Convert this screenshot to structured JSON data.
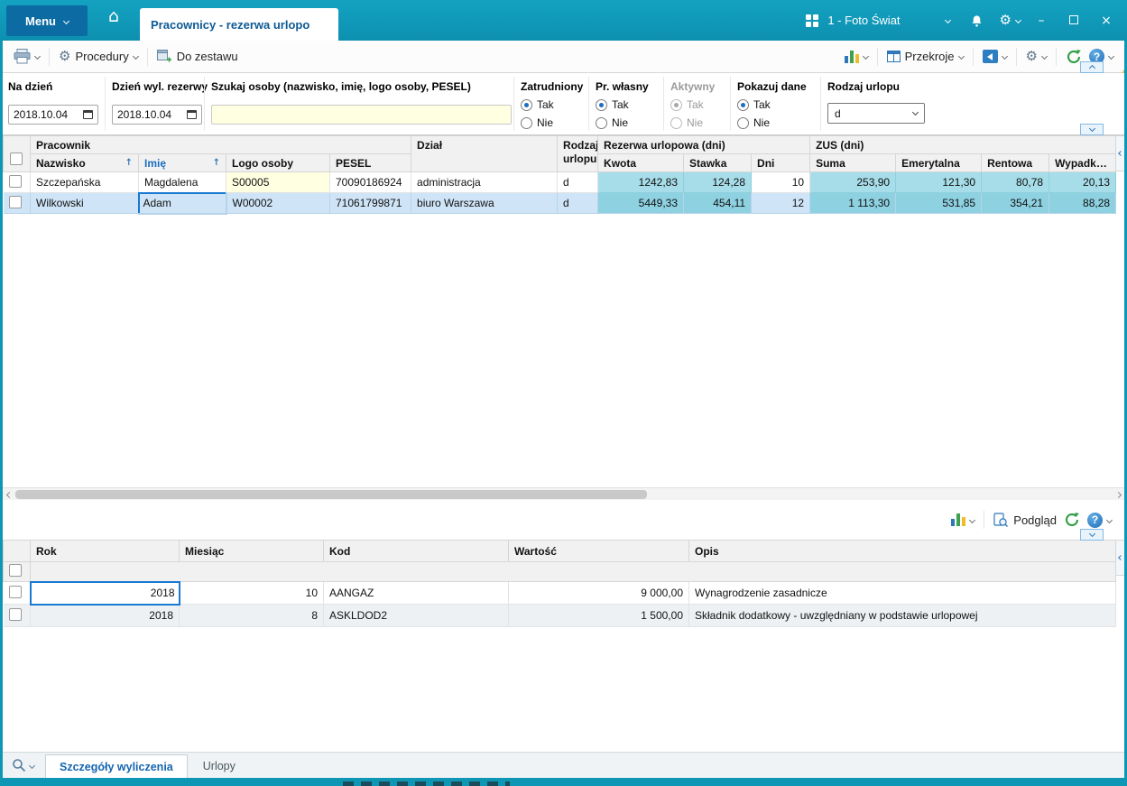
{
  "window": {
    "menu_label": "Menu",
    "tab_title": "Pracownicy - rezerwa urlopo",
    "company": "1 - Foto Świat"
  },
  "icons": {
    "home": "⌂",
    "gear": "⚙",
    "help": "?",
    "minimize": "–",
    "close": "×",
    "sort_asc": "↑"
  },
  "toolbar": {
    "procedury_label": "Procedury",
    "do_zestawu_label": "Do zestawu",
    "przekroje_label": "Przekroje"
  },
  "filters": {
    "na_dzien": {
      "label": "Na dzień",
      "value": "2018.10.04"
    },
    "dzien_wyl_rezerwy": {
      "label": "Dzień wyl. rezerwy",
      "value": "2018.10.04"
    },
    "szukaj": {
      "label": "Szukaj osoby (nazwisko, imię, logo osoby, PESEL)",
      "value": ""
    },
    "zatrudniony": {
      "label": "Zatrudniony",
      "option_yes": "Tak",
      "option_no": "Nie",
      "selected": "Tak"
    },
    "pr_wlasny": {
      "label": "Pr. własny",
      "option_yes": "Tak",
      "option_no": "Nie",
      "selected": "Tak"
    },
    "aktywny": {
      "label": "Aktywny",
      "option_yes": "Tak",
      "option_no": "Nie",
      "selected": "Tak",
      "disabled": true
    },
    "pokazuj_dane": {
      "label": "Pokazuj dane",
      "option_yes": "Tak",
      "option_no": "Nie",
      "selected": "Tak"
    },
    "rodzaj_urlopu": {
      "label": "Rodzaj urlopu",
      "value": "d"
    }
  },
  "main_grid": {
    "groups": {
      "pracownik": "Pracownik",
      "dzial": "Dział",
      "rodzaj_urlopu": "Rodzaj urlopu",
      "rezerwa": "Rezerwa urlopowa (dni)",
      "zus": "ZUS (dni)"
    },
    "columns": {
      "nazwisko": "Nazwisko",
      "imie": "Imię",
      "logo": "Logo osoby",
      "pesel": "PESEL",
      "kwota": "Kwota",
      "stawka": "Stawka",
      "dni": "Dni",
      "suma": "Suma",
      "emerytalna": "Emerytalna",
      "rentowa": "Rentowa",
      "wypadkowa": "Wypadkowa"
    },
    "rows": [
      {
        "nazwisko": "Szczepańska",
        "imie": "Magdalena",
        "logo": "S00005",
        "pesel": "70090186924",
        "dzial": "administracja",
        "rodzaj": "d",
        "kwota": "1242,83",
        "stawka": "124,28",
        "dni": "10",
        "suma": "253,90",
        "emerytalna": "121,30",
        "rentowa": "80,78",
        "wypadkowa": "20,13"
      },
      {
        "nazwisko": "Wilkowski",
        "imie": "Adam",
        "logo": "W00002",
        "pesel": "71061799871",
        "dzial": "biuro Warszawa",
        "rodzaj": "d",
        "kwota": "5449,33",
        "stawka": "454,11",
        "dni": "12",
        "suma": "1 113,30",
        "emerytalna": "531,85",
        "rentowa": "354,21",
        "wypadkowa": "88,28"
      }
    ]
  },
  "bottom_toolbar": {
    "podglad_label": "Podgląd"
  },
  "bottom_grid": {
    "columns": {
      "rok": "Rok",
      "miesiac": "Miesiąc",
      "kod": "Kod",
      "wartosc": "Wartość",
      "opis": "Opis"
    },
    "rows": [
      {
        "rok": "2018",
        "miesiac": "10",
        "kod": "AANGAZ",
        "wartosc": "9 000,00",
        "opis": "Wynagrodzenie zasadnicze"
      },
      {
        "rok": "2018",
        "miesiac": "8",
        "kod": "ASKLDOD2",
        "wartosc": "1 500,00",
        "opis": "Składnik dodatkowy - uwzględniany w podstawie urlopowej"
      }
    ]
  },
  "bottom_tabs": {
    "szczegoly": "Szczegóły wyliczenia",
    "urlopy": "Urlopy"
  },
  "colors": {
    "titlebar_teal": "#0e96b5",
    "menu_button_blue": "#0d6ba3",
    "selection_blue": "#cfe5f7",
    "highlight_cyan": "#a6dde9",
    "focus_border_blue": "#1879d2",
    "link_blue": "#1b6fc0",
    "input_yellow": "#ffffe1",
    "refresh_green": "#2f9e44"
  }
}
